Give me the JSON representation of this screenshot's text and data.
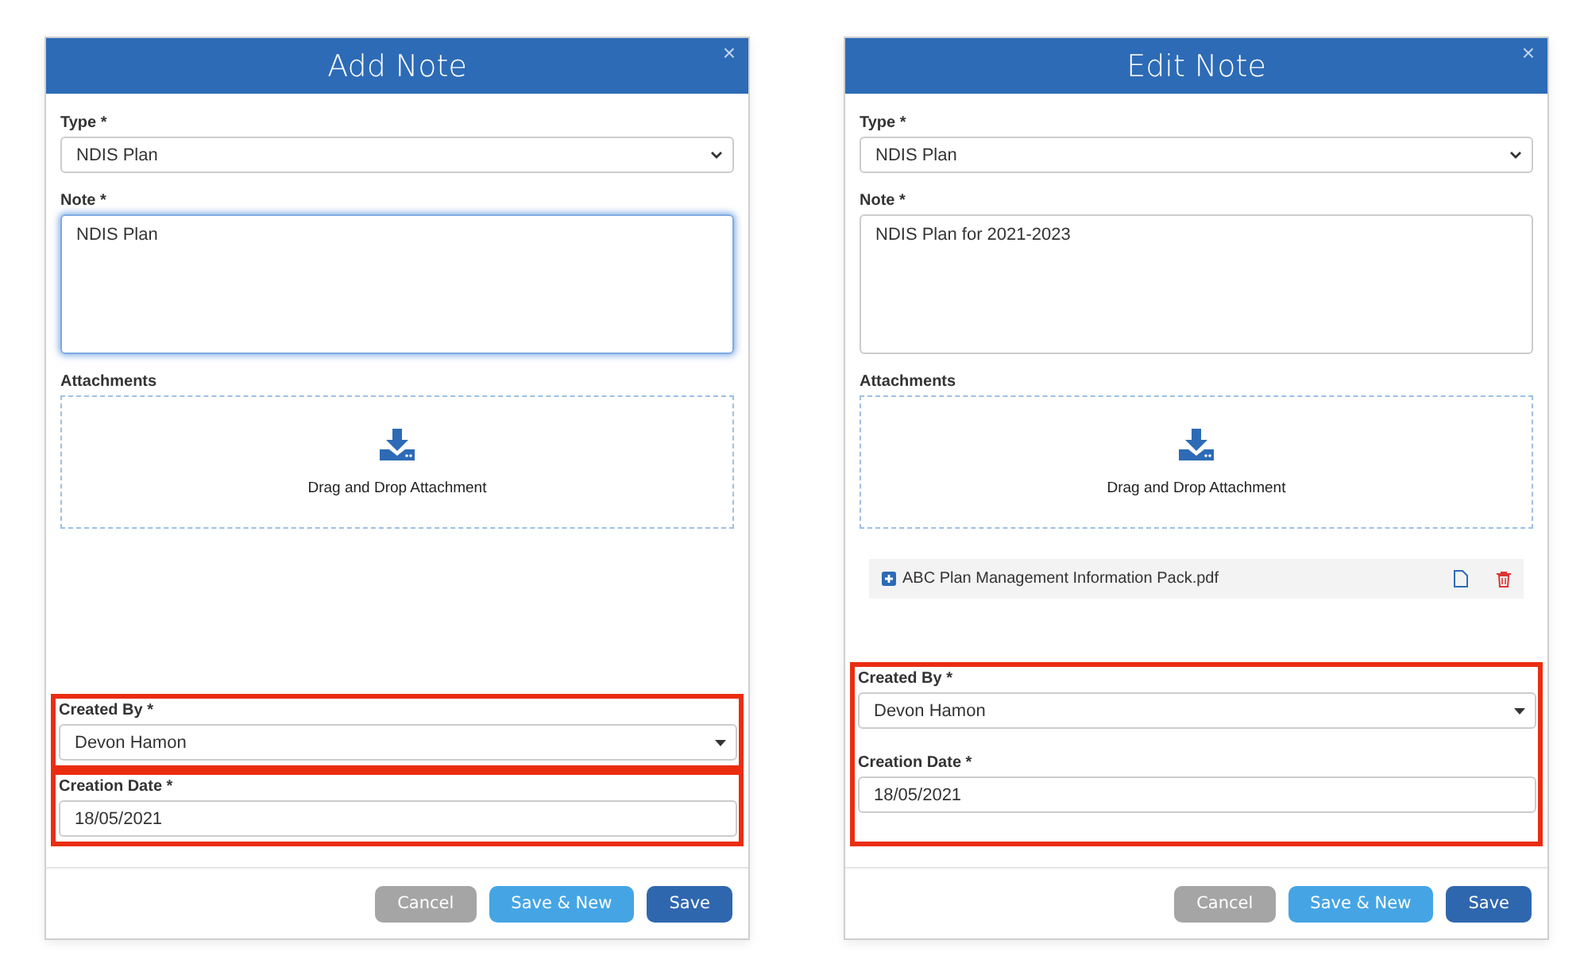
{
  "dialogs": [
    {
      "title": "Add Note",
      "close": "×",
      "fields": [
        {
          "kind": "select",
          "label": "Type *",
          "value": "NDIS Plan"
        },
        {
          "kind": "textarea",
          "label": "Note *",
          "value": "NDIS Plan",
          "focused": true
        },
        {
          "kind": "dropzone",
          "label": "Attachments",
          "text": "Drag and Drop Attachment"
        }
      ],
      "highlight_boxes": [
        {
          "highlighted": true,
          "fields": [
            {
              "kind": "combo",
              "label": "Created By *",
              "value": "Devon Hamon"
            }
          ]
        },
        {
          "highlighted": true,
          "fields": [
            {
              "kind": "date",
              "label": "Creation Date *",
              "value": "18/05/2021"
            }
          ]
        }
      ],
      "buttons": [
        {
          "label": "Cancel",
          "kind": "cancel",
          "disabled": true
        },
        {
          "label": "Save & New",
          "kind": "secondary",
          "disabled": false
        },
        {
          "label": "Save",
          "kind": "primary",
          "disabled": false
        }
      ]
    },
    {
      "title": "Edit Note",
      "close": "×",
      "fields": [
        {
          "kind": "select",
          "label": "Type *",
          "value": "NDIS Plan"
        },
        {
          "kind": "textarea",
          "label": "Note *",
          "value": "NDIS Plan for 2021-2023",
          "focused": false
        },
        {
          "kind": "dropzone",
          "label": "Attachments",
          "text": "Drag and Drop Attachment",
          "files": [
            {
              "name": "ABC Plan Management Information Pack.pdf"
            }
          ]
        }
      ],
      "highlight_boxes": [
        {
          "highlighted": true,
          "fields": [
            {
              "kind": "combo",
              "label": "Created By *",
              "value": "Devon Hamon"
            },
            {
              "kind": "date",
              "label": "Creation Date *",
              "value": "18/05/2021"
            }
          ]
        }
      ],
      "buttons": [
        {
          "label": "Cancel",
          "kind": "cancel",
          "disabled": true
        },
        {
          "label": "Save & New",
          "kind": "secondary",
          "disabled": false
        },
        {
          "label": "Save",
          "kind": "primary",
          "disabled": false
        }
      ]
    }
  ]
}
